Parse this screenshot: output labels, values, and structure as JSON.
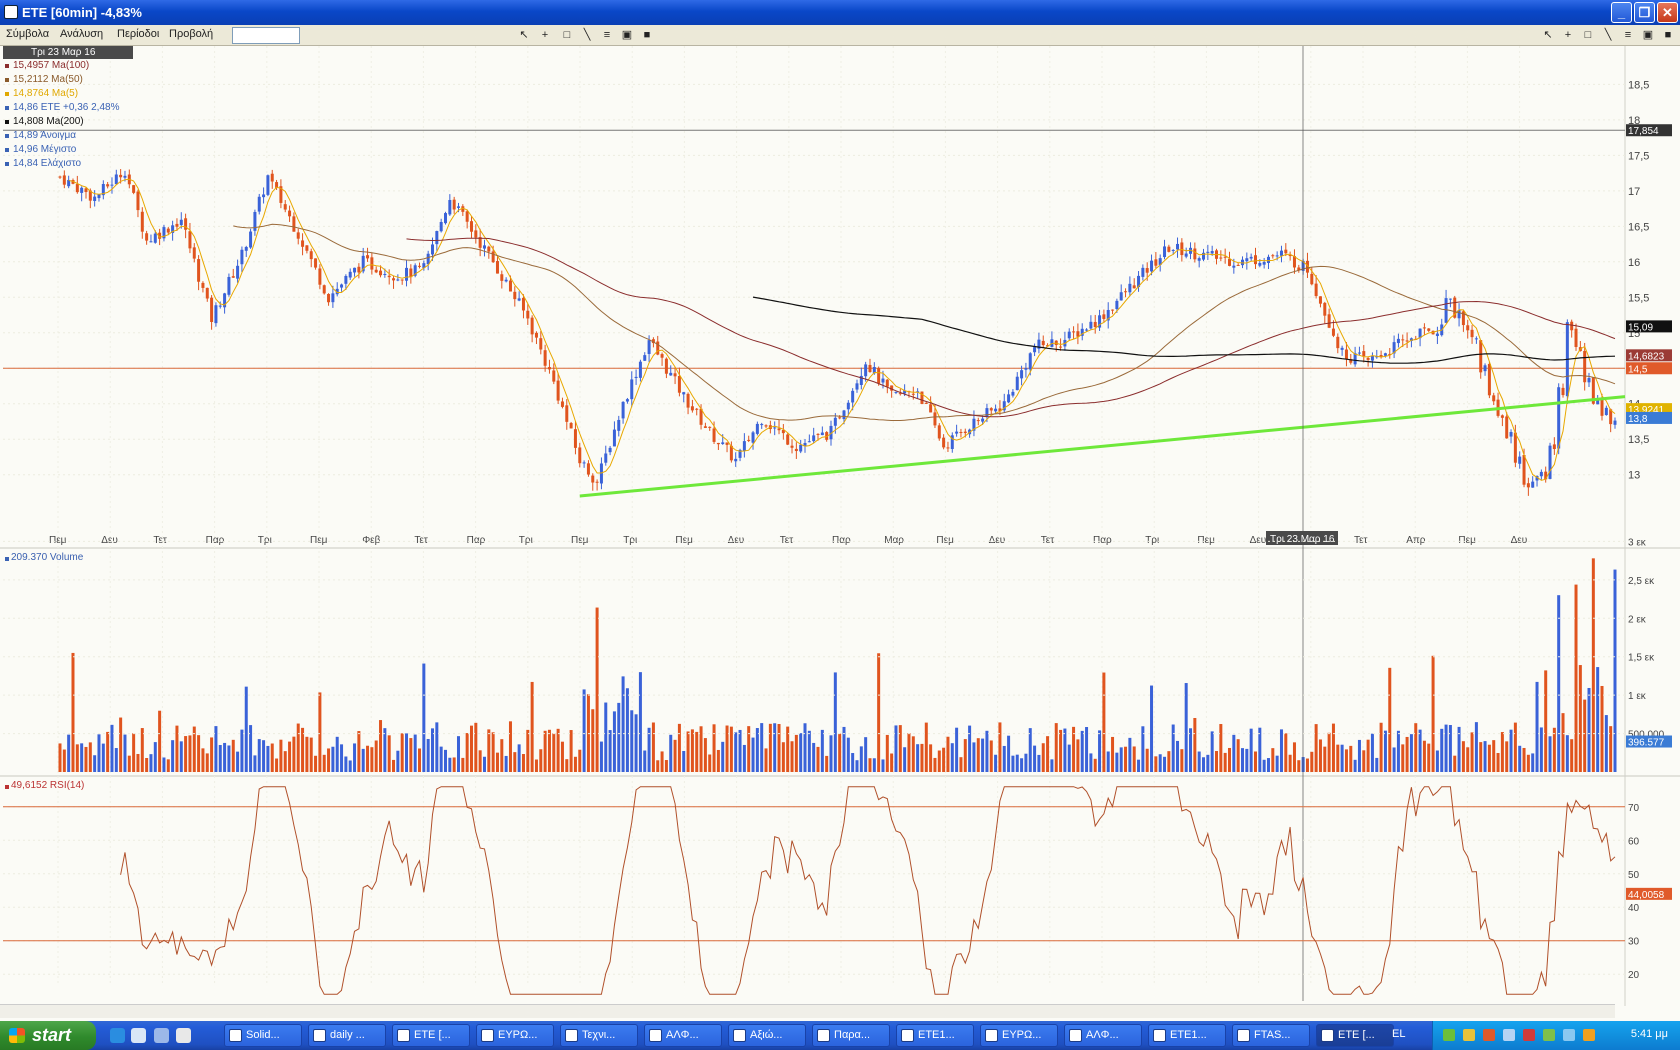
{
  "window": {
    "title": "ETE [60min] -4,83%"
  },
  "menu": [
    "Σύμβολα",
    "Ανάλυση",
    "Περίοδοι",
    "Προβολή"
  ],
  "legend": {
    "date": "Τρι 23 Μαρ 16",
    "rows": [
      {
        "text": "15,4957 Ma(100)",
        "color": "#8b2d2d"
      },
      {
        "text": "15,2112 Ma(50)",
        "color": "#8a5a2a"
      },
      {
        "text": "14,8764 Ma(5)",
        "color": "#e0a800"
      },
      {
        "text": "14,86 ETE +0,36 2,48%",
        "color": "#3a62b4"
      },
      {
        "text": "14,808 Ma(200)",
        "color": "#111111"
      },
      {
        "text": "14,89 Άνοιγμα",
        "color": "#3a62b4"
      },
      {
        "text": "14,96 Μέγιστο",
        "color": "#3a62b4"
      },
      {
        "text": "14,84 Ελάχιστο",
        "color": "#3a62b4"
      }
    ]
  },
  "price_axis": {
    "ticks": [
      "18,5",
      "18",
      "17,5",
      "17",
      "16,5",
      "16",
      "15,5",
      "15",
      "14,5",
      "14",
      "13,5",
      "13"
    ],
    "badges": [
      {
        "text": "17,854",
        "value": 17.854,
        "bg": "#333333"
      },
      {
        "text": "15,09",
        "value": 15.09,
        "bg": "#111111"
      },
      {
        "text": "14,6823",
        "value": 14.6823,
        "bg": "#9b3b35"
      },
      {
        "text": "14,5",
        "value": 14.5,
        "bg": "#e05a2a"
      },
      {
        "text": "13,9241",
        "value": 13.9241,
        "bg": "#e0b300"
      },
      {
        "text": "13,8",
        "value": 13.8,
        "bg": "#3a7bd5"
      }
    ]
  },
  "cursor_label": "Τρι 23 Μαρ 16",
  "time_axis": [
    "Πεμ",
    "Δευ",
    "Τετ",
    "Παρ",
    "Τρι",
    "Πεμ",
    "Φεβ",
    "Τετ",
    "Παρ",
    "Τρι",
    "Πεμ",
    "Τρι",
    "Πεμ",
    "Δευ",
    "Τετ",
    "Παρ",
    "Μαρ",
    "Πεμ",
    "Δευ",
    "Τετ",
    "Παρ",
    "Τρι",
    "Πεμ",
    "Δευ",
    "Δευ",
    "Τετ",
    "Απρ",
    "Πεμ",
    "Δευ"
  ],
  "volume": {
    "legend": "209.370 Volume",
    "ticks": [
      "3 εκ",
      "2,5 εκ",
      "2 εκ",
      "1,5 εκ",
      "1 εκ",
      "500.000"
    ],
    "badge": "396.577"
  },
  "rsi": {
    "legend": "49,6152 RSI(14)",
    "ticks": [
      "70",
      "60",
      "50",
      "40",
      "30",
      "20"
    ],
    "badge": "44,0058"
  },
  "colors": {
    "up": "#3a62d8",
    "down": "#e0541e",
    "ma5": "#e8a800",
    "ma50": "#9a6a3a",
    "ma100": "#8b2d2d",
    "ma200": "#111111",
    "trend": "#6ee83a",
    "rsi": "#b0502a",
    "hline": "#d96a3a"
  },
  "chart_data": {
    "type": "candlestick",
    "title": "ETE [60min] -4,83%",
    "ylim": [
      12.7,
      18.9
    ],
    "hlines": [
      17.854,
      14.5
    ],
    "trendline": {
      "from": 12.7,
      "to": 14.1
    },
    "rsi_levels": [
      70,
      30
    ],
    "volume_max": 3200000
  },
  "taskbar": {
    "start": "start",
    "tasks": [
      "Solid...",
      "daily ...",
      "ETE [...",
      "ΕΥΡΩ...",
      "Τεχνι...",
      "ΑΛΦ...",
      "Αξιώ...",
      "Παρα...",
      "ETE1...",
      "ΕΥΡΩ...",
      "ΑΛΦ...",
      "ETE1...",
      "FTAS...",
      "ETE [..."
    ],
    "lang": "EL",
    "clock": "5:41 μμ"
  }
}
